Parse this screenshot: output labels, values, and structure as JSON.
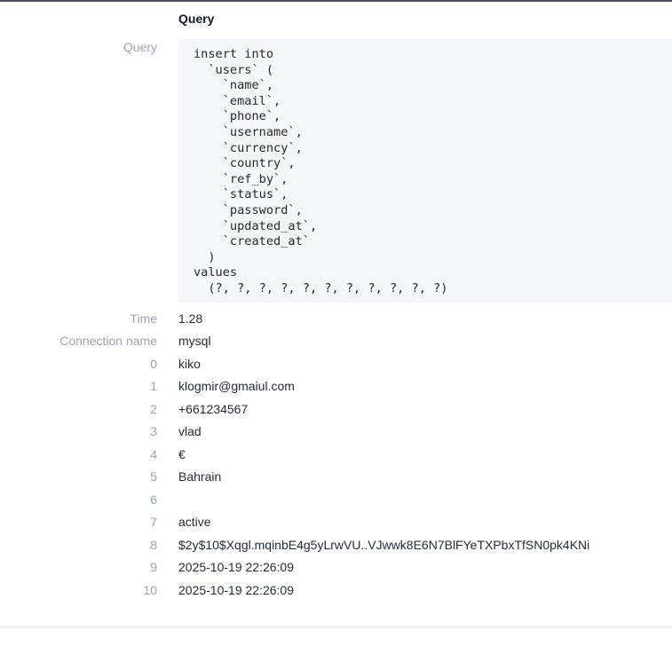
{
  "section": {
    "title": "Query"
  },
  "query": {
    "label": "Query",
    "sql": "insert into\n  `users` (\n    `name`,\n    `email`,\n    `phone`,\n    `username`,\n    `currency`,\n    `country`,\n    `ref_by`,\n    `status`,\n    `password`,\n    `updated_at`,\n    `created_at`\n  )\nvalues\n  (?, ?, ?, ?, ?, ?, ?, ?, ?, ?, ?)"
  },
  "details": [
    {
      "label": "Time",
      "value": "1.28"
    },
    {
      "label": "Connection name",
      "value": "mysql"
    },
    {
      "label": "0",
      "value": "kiko"
    },
    {
      "label": "1",
      "value": "klogmir@gmaiul.com"
    },
    {
      "label": "2",
      "value": "+661234567"
    },
    {
      "label": "3",
      "value": "vlad"
    },
    {
      "label": "4",
      "value": "€"
    },
    {
      "label": "5",
      "value": "Bahrain"
    },
    {
      "label": "6",
      "value": ""
    },
    {
      "label": "7",
      "value": "active"
    },
    {
      "label": "8",
      "value": "$2y$10$Xqgl.mqinbE4g5yLrwVU..VJwwk8E6N7BlFYeTXPbxTfSN0pk4KNi"
    },
    {
      "label": "9",
      "value": "2025-10-19 22:26:09"
    },
    {
      "label": "10",
      "value": "2025-10-19 22:26:09"
    }
  ]
}
